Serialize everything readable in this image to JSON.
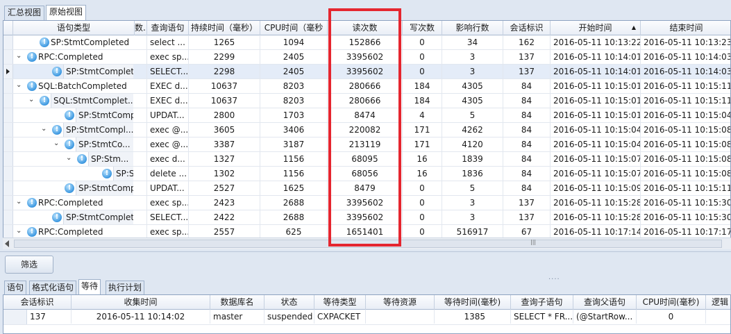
{
  "top_tabs": [
    "汇总视图",
    "原始视图"
  ],
  "grid": {
    "columns": [
      "语句类型",
      "数...",
      "查询语句",
      "持续时间（毫秒）",
      "CPU时间（毫秒",
      "读次数",
      "写次数",
      "影响行数",
      "会话标识",
      "开始时间",
      "结束时间"
    ],
    "sort_indicator": "▲",
    "rows": [
      {
        "type": "SP:StmtCompleted",
        "query": "select ...",
        "duration": "1265",
        "cpu": "1094",
        "reads": "152866",
        "writes": "0",
        "rows": "34",
        "session": "162",
        "start": "2016-05-11 10:13:22",
        "end": "2016-05-11 10:13:23"
      },
      {
        "type": "RPC:Completed",
        "query": "exec sp...",
        "duration": "2299",
        "cpu": "2405",
        "reads": "3395602",
        "writes": "0",
        "rows": "3",
        "session": "137",
        "start": "2016-05-11 10:14:01",
        "end": "2016-05-11 10:14:03"
      },
      {
        "type": "SP:StmtCompleted",
        "query": "SELECT...",
        "duration": "2298",
        "cpu": "2405",
        "reads": "3395602",
        "writes": "0",
        "rows": "3",
        "session": "137",
        "start": "2016-05-11 10:14:01",
        "end": "2016-05-11 10:14:03"
      },
      {
        "type": "SQL:BatchCompleted",
        "query": "EXEC d...",
        "duration": "10637",
        "cpu": "8203",
        "reads": "280666",
        "writes": "184",
        "rows": "4305",
        "session": "84",
        "start": "2016-05-11 10:15:01",
        "end": "2016-05-11 10:15:11"
      },
      {
        "type": "SQL:StmtComplet...",
        "query": "EXEC d...",
        "duration": "10637",
        "cpu": "8203",
        "reads": "280666",
        "writes": "184",
        "rows": "4305",
        "session": "84",
        "start": "2016-05-11 10:15:01",
        "end": "2016-05-11 10:15:11"
      },
      {
        "type": "SP:StmtCompl...",
        "query": "UPDAT...",
        "duration": "2800",
        "cpu": "1703",
        "reads": "8474",
        "writes": "4",
        "rows": "5",
        "session": "84",
        "start": "2016-05-11 10:15:01",
        "end": "2016-05-11 10:15:04"
      },
      {
        "type": "SP:StmtCompl...",
        "query": "exec @...",
        "duration": "3605",
        "cpu": "3406",
        "reads": "220082",
        "writes": "171",
        "rows": "4262",
        "session": "84",
        "start": "2016-05-11 10:15:04",
        "end": "2016-05-11 10:15:08"
      },
      {
        "type": "SP:StmtCo...",
        "query": "exec @...",
        "duration": "3387",
        "cpu": "3187",
        "reads": "213119",
        "writes": "171",
        "rows": "4120",
        "session": "84",
        "start": "2016-05-11 10:15:04",
        "end": "2016-05-11 10:15:08"
      },
      {
        "type": "SP:Stm...",
        "query": "exec d...",
        "duration": "1327",
        "cpu": "1156",
        "reads": "68095",
        "writes": "16",
        "rows": "1839",
        "session": "84",
        "start": "2016-05-11 10:15:07",
        "end": "2016-05-11 10:15:08"
      },
      {
        "type": "SP:S...",
        "query": "delete ...",
        "duration": "1302",
        "cpu": "1156",
        "reads": "68056",
        "writes": "16",
        "rows": "1836",
        "session": "84",
        "start": "2016-05-11 10:15:07",
        "end": "2016-05-11 10:15:08"
      },
      {
        "type": "SP:StmtCompl...",
        "query": "UPDAT...",
        "duration": "2527",
        "cpu": "1625",
        "reads": "8479",
        "writes": "0",
        "rows": "5",
        "session": "84",
        "start": "2016-05-11 10:15:09",
        "end": "2016-05-11 10:15:11"
      },
      {
        "type": "RPC:Completed",
        "query": "exec sp...",
        "duration": "2423",
        "cpu": "2688",
        "reads": "3395602",
        "writes": "0",
        "rows": "3",
        "session": "137",
        "start": "2016-05-11 10:15:28",
        "end": "2016-05-11 10:15:30"
      },
      {
        "type": "SP:StmtCompleted",
        "query": "SELECT...",
        "duration": "2422",
        "cpu": "2688",
        "reads": "3395602",
        "writes": "0",
        "rows": "3",
        "session": "137",
        "start": "2016-05-11 10:15:28",
        "end": "2016-05-11 10:15:30"
      },
      {
        "type": "RPC:Completed",
        "query": "exec sp...",
        "duration": "2557",
        "cpu": "625",
        "reads": "1651401",
        "writes": "0",
        "rows": "516917",
        "session": "67",
        "start": "2016-05-11 10:17:14",
        "end": "2016-05-11 10:17:17"
      }
    ]
  },
  "scroll_grip": "|||",
  "filter_button": "筛选",
  "splitter_grip": "....",
  "bottom_tabs": [
    "语句",
    "格式化语句",
    "等待",
    "执行计划"
  ],
  "detail": {
    "columns": [
      "会话标识",
      "收集时间",
      "数据库名",
      "状态",
      "等待类型",
      "等待资源",
      "等待时间(毫秒)",
      "查询子语句",
      "查询父语句",
      "CPU时间(毫秒)",
      "逻辑"
    ],
    "row": [
      "137",
      "2016-05-11 10:14:02",
      "master",
      "suspended",
      "CXPACKET",
      "",
      "1385",
      "SELECT * FR...",
      "(@StartRow...",
      "0",
      ""
    ]
  },
  "colors": {
    "highlight": "#e5262f",
    "info_icon": "#3b97e0",
    "selected_row": "#e4ecf8"
  }
}
